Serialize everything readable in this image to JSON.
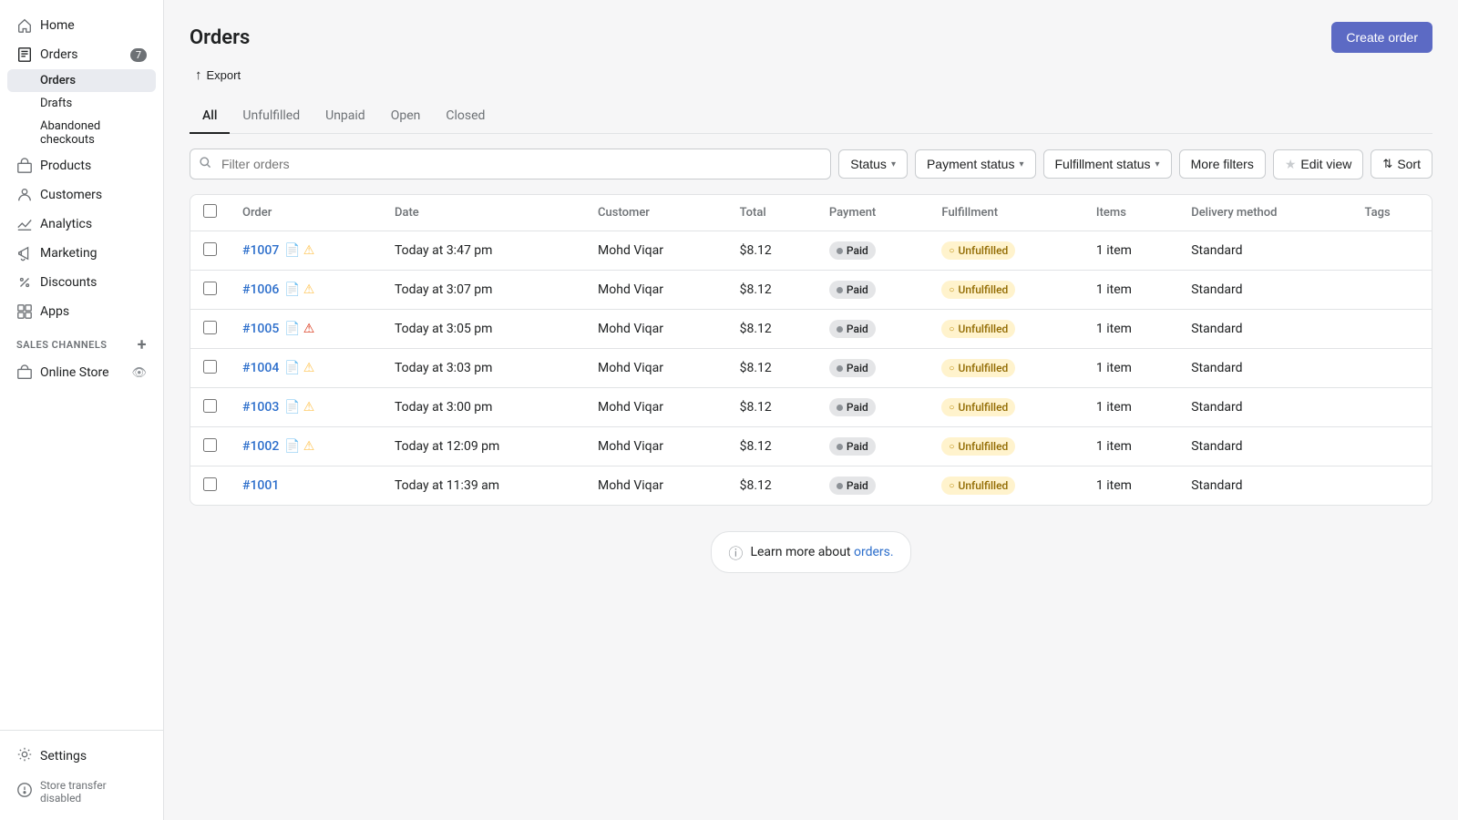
{
  "sidebar": {
    "nav_items": [
      {
        "id": "home",
        "label": "Home",
        "icon": "home-icon",
        "active": false
      },
      {
        "id": "orders",
        "label": "Orders",
        "icon": "orders-icon",
        "active": true,
        "badge": "7"
      },
      {
        "id": "products",
        "label": "Products",
        "icon": "products-icon",
        "active": false
      },
      {
        "id": "customers",
        "label": "Customers",
        "icon": "customers-icon",
        "active": false
      },
      {
        "id": "analytics",
        "label": "Analytics",
        "icon": "analytics-icon",
        "active": false
      },
      {
        "id": "marketing",
        "label": "Marketing",
        "icon": "marketing-icon",
        "active": false
      },
      {
        "id": "discounts",
        "label": "Discounts",
        "icon": "discounts-icon",
        "active": false
      },
      {
        "id": "apps",
        "label": "Apps",
        "icon": "apps-icon",
        "active": false
      }
    ],
    "orders_sub": [
      {
        "id": "orders-sub",
        "label": "Orders",
        "active": true
      },
      {
        "id": "drafts",
        "label": "Drafts",
        "active": false
      },
      {
        "id": "abandoned",
        "label": "Abandoned checkouts",
        "active": false
      }
    ],
    "sales_channels_label": "SALES CHANNELS",
    "sales_channels": [
      {
        "id": "online-store",
        "label": "Online Store"
      }
    ],
    "settings_label": "Settings",
    "store_transfer_label": "Store transfer disabled"
  },
  "page": {
    "title": "Orders",
    "export_label": "Export",
    "create_order_label": "Create order"
  },
  "tabs": [
    {
      "id": "all",
      "label": "All",
      "active": true
    },
    {
      "id": "unfulfilled",
      "label": "Unfulfilled",
      "active": false
    },
    {
      "id": "unpaid",
      "label": "Unpaid",
      "active": false
    },
    {
      "id": "open",
      "label": "Open",
      "active": false
    },
    {
      "id": "closed",
      "label": "Closed",
      "active": false
    }
  ],
  "filters": {
    "search_placeholder": "Filter orders",
    "status_label": "Status",
    "payment_status_label": "Payment status",
    "fulfillment_status_label": "Fulfillment status",
    "more_filters_label": "More filters",
    "edit_view_label": "Edit view",
    "sort_label": "Sort"
  },
  "table": {
    "columns": [
      "",
      "Order",
      "Date",
      "Customer",
      "Total",
      "Payment",
      "Fulfillment",
      "Items",
      "Delivery method",
      "Tags"
    ],
    "rows": [
      {
        "id": "1007",
        "order": "#1007",
        "date": "Today at 3:47 pm",
        "customer": "Mohd Viqar",
        "total": "$8.12",
        "payment": "Paid",
        "fulfillment": "Unfulfilled",
        "items": "1 item",
        "delivery": "Standard",
        "has_doc": true,
        "has_warn": true,
        "warn_type": "yellow"
      },
      {
        "id": "1006",
        "order": "#1006",
        "date": "Today at 3:07 pm",
        "customer": "Mohd Viqar",
        "total": "$8.12",
        "payment": "Paid",
        "fulfillment": "Unfulfilled",
        "items": "1 item",
        "delivery": "Standard",
        "has_doc": true,
        "has_warn": true,
        "warn_type": "yellow"
      },
      {
        "id": "1005",
        "order": "#1005",
        "date": "Today at 3:05 pm",
        "customer": "Mohd Viqar",
        "total": "$8.12",
        "payment": "Paid",
        "fulfillment": "Unfulfilled",
        "items": "1 item",
        "delivery": "Standard",
        "has_doc": true,
        "has_warn": true,
        "warn_type": "red"
      },
      {
        "id": "1004",
        "order": "#1004",
        "date": "Today at 3:03 pm",
        "customer": "Mohd Viqar",
        "total": "$8.12",
        "payment": "Paid",
        "fulfillment": "Unfulfilled",
        "items": "1 item",
        "delivery": "Standard",
        "has_doc": true,
        "has_warn": true,
        "warn_type": "yellow"
      },
      {
        "id": "1003",
        "order": "#1003",
        "date": "Today at 3:00 pm",
        "customer": "Mohd Viqar",
        "total": "$8.12",
        "payment": "Paid",
        "fulfillment": "Unfulfilled",
        "items": "1 item",
        "delivery": "Standard",
        "has_doc": true,
        "has_warn": true,
        "warn_type": "yellow"
      },
      {
        "id": "1002",
        "order": "#1002",
        "date": "Today at 12:09 pm",
        "customer": "Mohd Viqar",
        "total": "$8.12",
        "payment": "Paid",
        "fulfillment": "Unfulfilled",
        "items": "1 item",
        "delivery": "Standard",
        "has_doc": true,
        "has_warn": true,
        "warn_type": "yellow"
      },
      {
        "id": "1001",
        "order": "#1001",
        "date": "Today at 11:39 am",
        "customer": "Mohd Viqar",
        "total": "$8.12",
        "payment": "Paid",
        "fulfillment": "Unfulfilled",
        "items": "1 item",
        "delivery": "Standard",
        "has_doc": false,
        "has_warn": false,
        "warn_type": ""
      }
    ]
  },
  "learn_more": {
    "text": "Learn more about ",
    "link_text": "orders.",
    "link_href": "#"
  }
}
